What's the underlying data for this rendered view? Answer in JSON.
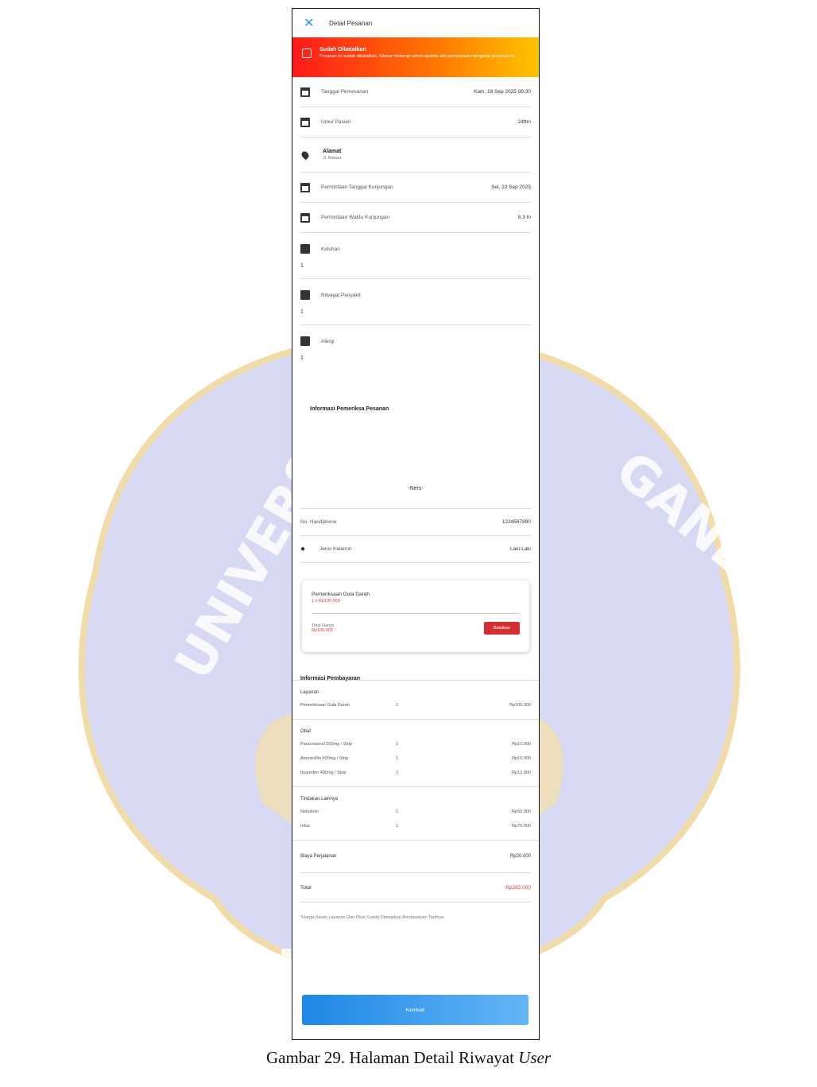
{
  "appbar": {
    "title": "Detail Pesanan"
  },
  "banner": {
    "title": "Sudah Dibatalkan",
    "message": "Pesanan ini sudah dibatalkan. Silakan hubungi admin apabila ada pertanyaan mengenai pesanan ini."
  },
  "details": [
    {
      "icon": "calendar-icon",
      "label": "Tanggal Pemesanan",
      "value": "Kam, 18 Sep 2025 09.30"
    },
    {
      "icon": "calendar-icon",
      "label": "Umur Pasien",
      "value": "24thn"
    },
    {
      "icon": "calendar-icon",
      "label": "Permintaan Tanggal Kunjungan",
      "value": "Sel, 23 Sep 2025"
    },
    {
      "icon": "calendar-icon",
      "label": "Permintaan Waktu Kunjungan",
      "value": "8.3 tn"
    }
  ],
  "alamat": {
    "title": "Alamat",
    "value": "Jl. Mawar"
  },
  "counts": [
    {
      "label": "Keluhan",
      "value": "1"
    },
    {
      "label": "Riwayat Penyakit",
      "value": "1"
    },
    {
      "label": "Alergi",
      "value": "1"
    }
  ],
  "pemeriksa": {
    "title": "Informasi Pemeriksa Pesanan",
    "placeholder": "-Ners-",
    "phone_label": "No. Handphone",
    "phone_value": "1234567890",
    "gender_label": "Jenis Kelamin",
    "gender_value": "Laki-Laki"
  },
  "service_card": {
    "title": "Pemeriksaan Gula Darah",
    "subtitle": "1 x Rp100.000",
    "price_label": "Total Harga",
    "price_value": "Rp100.000",
    "button_label": "Batalkan"
  },
  "payment": {
    "title": "Informasi Pembayaran",
    "groups": [
      {
        "title": "Layanan",
        "items": [
          {
            "name": "Pemeriksaan Gula Darah",
            "qty": "1",
            "price": "Rp100.000"
          }
        ]
      },
      {
        "title": "Obat",
        "items": [
          {
            "name": "Paracetamol 500mg / Strip",
            "qty": "1",
            "price": "Rp10.000"
          },
          {
            "name": "Amoxicillin 500mg / Strip",
            "qty": "1",
            "price": "Rp15.000"
          },
          {
            "name": "Ibuprofen 400mg / Strip",
            "qty": "1",
            "price": "Rp12.000"
          }
        ]
      },
      {
        "title": "Tindakan Lainnya",
        "items": [
          {
            "name": "Nebulizer",
            "qty": "1",
            "price": "Rp50.000"
          },
          {
            "name": "Infus",
            "qty": "1",
            "price": "Rp75.000"
          }
        ]
      }
    ],
    "transport_label": "Biaya Perjalanan",
    "transport_value": "Rp20.000",
    "total_label": "Total",
    "total_value": "Rp282.000",
    "note": "*Harga Selain Layanan Dan Obat Sudah Ditetapkan Berdasarkan Tarifnya"
  },
  "button_label": "Kembali",
  "caption_main": "Gambar 29. Halaman Detail Riwayat ",
  "caption_italic": "User"
}
